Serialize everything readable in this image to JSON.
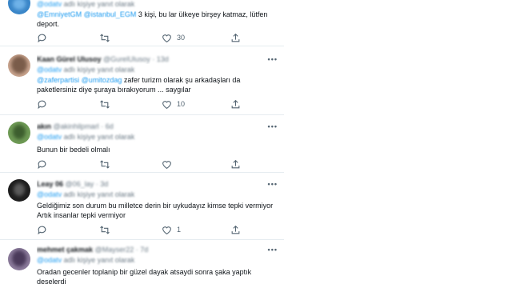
{
  "tweets": [
    {
      "name": "",
      "handle": "",
      "time": "",
      "reply_prefix": "adlı kişiye yanıt olarak",
      "reply_handle": "@odatv",
      "text_mentions": [
        "@EmniyetGM",
        "@istanbul_EGM"
      ],
      "text": " 3 kişi, bu lar ülkeye birşey katmaz, lütfen deport.",
      "likes": "30",
      "retweets": "",
      "replies": "",
      "avatar_color": "#3a86c8"
    },
    {
      "name": "Kaan Gürel Ulusoy",
      "handle": "@GurelUlusoy",
      "time": "13d",
      "reply_prefix": "adlı kişiye yanıt olarak",
      "reply_handle": "@odatv",
      "text_mentions": [
        "@zaferpartisi",
        "@umitozdag"
      ],
      "text": " zafer turizm olarak şu arkadaşları da paketlersiniz diye şuraya bırakıyorum ... saygılar",
      "likes": "10",
      "retweets": "",
      "replies": "",
      "avatar_color": "#7a5c4a"
    },
    {
      "name": "akın",
      "handle": "@akinhilpmarl",
      "time": "6d",
      "reply_prefix": "adlı kişiye yanıt olarak",
      "reply_handle": "@odatv",
      "text": "Bunun bir bedeli olmalı",
      "likes": "",
      "retweets": "",
      "replies": "",
      "avatar_color": "#4a7a3a"
    },
    {
      "name": "Leay 06",
      "handle": "@06_lay",
      "time": "3d",
      "reply_prefix": "adlı kişiye yanıt olarak",
      "reply_handle": "@odatv",
      "text_lines": [
        "Geldiğimiz son durum bu milletce derin bir uykudayız kimse tepki vermiyor",
        "Artık insanlar tepki vermiyor"
      ],
      "likes": "1",
      "retweets": "",
      "replies": "",
      "avatar_color": "#2b2b2b"
    },
    {
      "name": "mehmet çakmak",
      "handle": "@Mayser22",
      "time": "7d",
      "reply_prefix": "adlı kişiye yanıt olarak",
      "reply_handle": "@odatv",
      "text": "Oradan gecenler toplanip bir güzel dayak atsaydi sonra şaka yaptık deselerdi",
      "likes": "",
      "retweets": "",
      "replies": "",
      "avatar_color": "#5a4a6a"
    }
  ]
}
